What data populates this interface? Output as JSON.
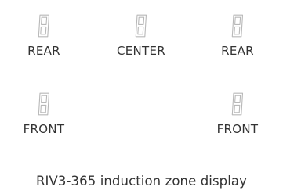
{
  "zones": [
    {
      "id": "rear-left",
      "label": "REAR",
      "digit": "8"
    },
    {
      "id": "center",
      "label": "CENTER",
      "digit": "8"
    },
    {
      "id": "rear-right",
      "label": "REAR",
      "digit": "8"
    },
    {
      "id": "front-left",
      "label": "FRONT",
      "digit": "8"
    },
    {
      "id": "front-right",
      "label": "FRONT",
      "digit": "8"
    }
  ],
  "caption": "RIV3-365 induction zone display",
  "colors": {
    "segment": "#b8b8b8",
    "label": "#333333",
    "background": "#ffffff"
  },
  "icons": {
    "digit": "seven-segment-digit-icon"
  }
}
